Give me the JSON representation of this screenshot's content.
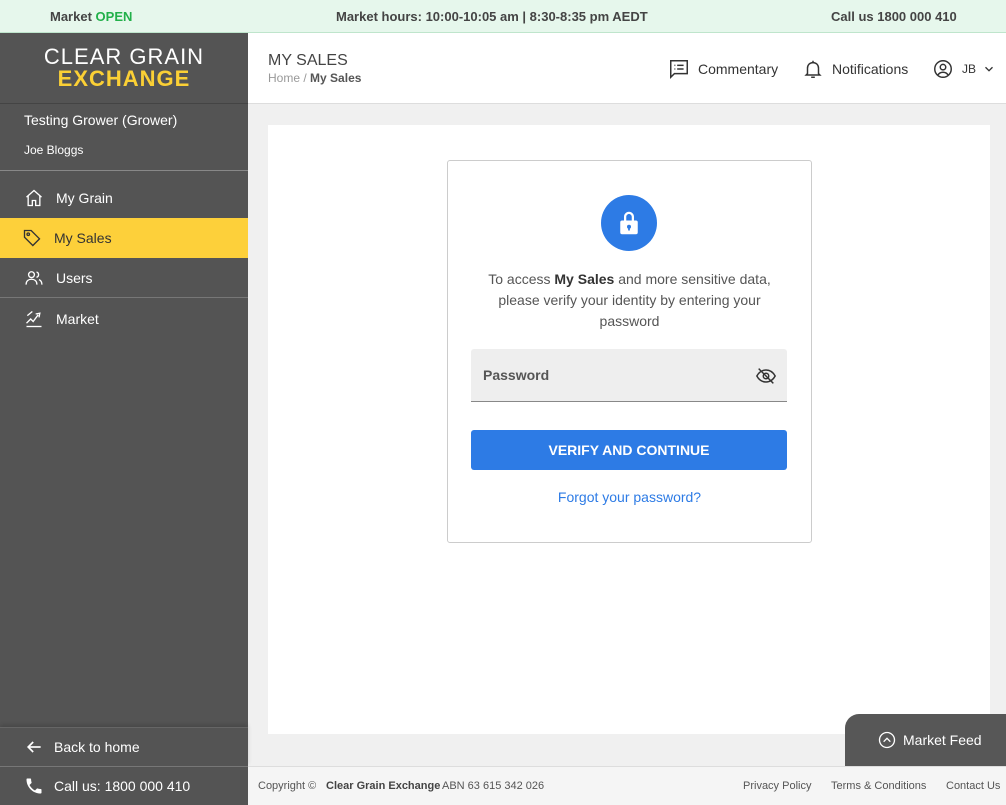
{
  "topbar": {
    "market_label": "Market",
    "market_status": "OPEN",
    "hours": "Market hours: 10:00-10:05 am | 8:30-8:35 pm AEDT",
    "call": "Call us 1800 000 410"
  },
  "logo": {
    "line1": "CLEAR GRAIN",
    "line2": "EXCHANGE"
  },
  "sidebar": {
    "org": "Testing Grower (Grower)",
    "user": "Joe Bloggs",
    "items": [
      {
        "label": "My Grain",
        "icon": "home-icon"
      },
      {
        "label": "My Sales",
        "icon": "tag-icon"
      },
      {
        "label": "Users",
        "icon": "users-icon"
      },
      {
        "label": "Market",
        "icon": "market-icon"
      }
    ],
    "back_home": "Back to home",
    "call": "Call us: 1800 000 410"
  },
  "header": {
    "title": "MY SALES",
    "crumb_home": "Home",
    "crumb_sep": "/",
    "crumb_current": "My Sales",
    "commentary": "Commentary",
    "notifications": "Notifications",
    "user_initials": "JB"
  },
  "card": {
    "msg_pre": "To access",
    "msg_bold": "My Sales",
    "msg_post": "and more sensitive data, please verify your identity by entering your password",
    "password_placeholder": "Password",
    "verify": "VERIFY AND CONTINUE",
    "forgot": "Forgot your password?"
  },
  "feed": {
    "label": "Market Feed"
  },
  "footer": {
    "copyright": "Copyright ©",
    "company": "Clear Grain Exchange",
    "abn": "ABN 63 615 342 026",
    "privacy": "Privacy Policy",
    "terms": "Terms & Conditions",
    "contact": "Contact Us"
  },
  "colors": {
    "accent": "#2d7be5",
    "highlight": "#fdd03a",
    "sidebar": "#545454",
    "open": "#22b04a"
  }
}
